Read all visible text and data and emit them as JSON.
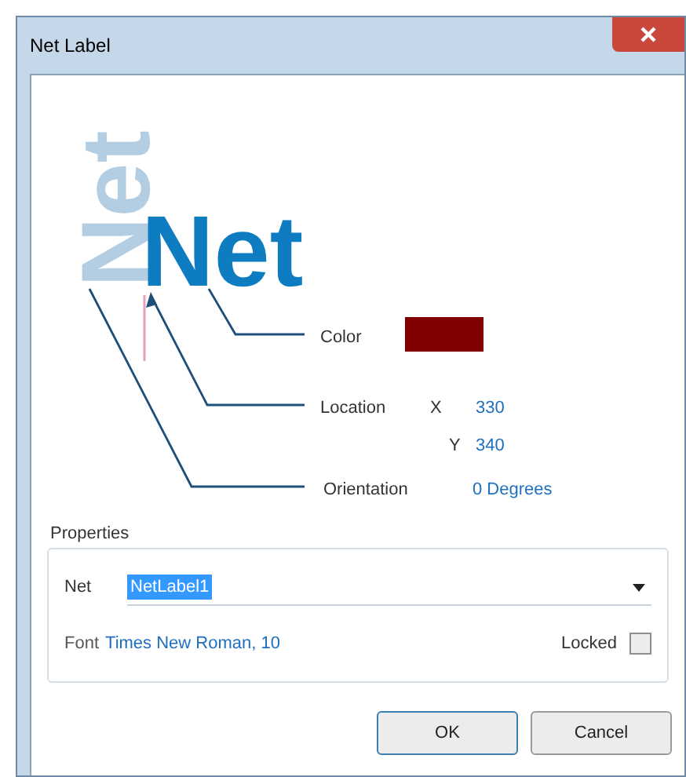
{
  "window": {
    "title": "Net Label"
  },
  "preview": {
    "text": "Net",
    "rotated_text": "Net"
  },
  "callouts": [
    {
      "kind": "color",
      "label": "Color",
      "color": "#800000"
    },
    {
      "kind": "location",
      "label": "Location",
      "x_label": "X",
      "x_value": "330",
      "y_label": "Y",
      "y_value": "340"
    },
    {
      "kind": "orientation",
      "label": "Orientation",
      "value": "0 Degrees"
    }
  ],
  "properties": {
    "title": "Properties",
    "net_label": "Net",
    "net_value": "NetLabel1",
    "net_value_selected": true,
    "font_label": "Font",
    "font_value": "Times New Roman, 10",
    "locked_label": "Locked",
    "locked_checked": false
  },
  "buttons": [
    {
      "label": "OK",
      "default": true
    },
    {
      "label": "Cancel",
      "default": false
    }
  ]
}
